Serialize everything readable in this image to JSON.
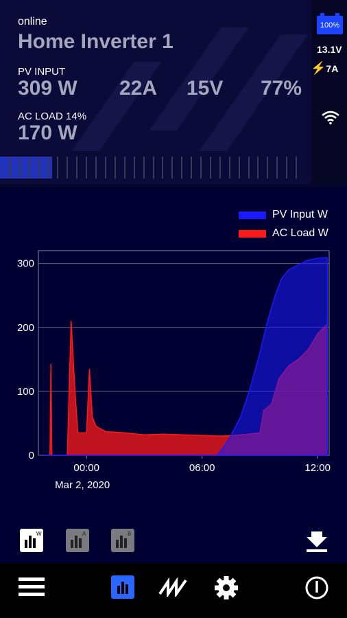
{
  "device": {
    "status": "online",
    "name": "Home Inverter 1"
  },
  "pv": {
    "label": "PV INPUT",
    "power": "309 W",
    "current": "22A",
    "voltage": "15V",
    "percent": "77%"
  },
  "ac": {
    "label": "AC LOAD 14%",
    "power": "170 W",
    "load_fraction": 0.14
  },
  "side": {
    "battery_percent": "100%",
    "battery_voltage": "13.1V",
    "charge_current": "7A"
  },
  "chart_data": {
    "type": "area",
    "series": [
      {
        "name": "PV Input W",
        "color": "#1a1aff"
      },
      {
        "name": "AC Load W",
        "color": "#ff1a1a"
      }
    ],
    "yticks": [
      "0",
      "100",
      "200",
      "300"
    ],
    "ylim": [
      0,
      320
    ],
    "xticks": [
      "00:00",
      "06:00",
      "12:00"
    ],
    "xdate": "Mar 2, 2020",
    "pv_points": [
      [
        -2.2,
        0
      ],
      [
        6.8,
        0
      ],
      [
        7.4,
        25
      ],
      [
        8.0,
        60
      ],
      [
        8.5,
        105
      ],
      [
        9.0,
        160
      ],
      [
        9.4,
        210
      ],
      [
        9.8,
        250
      ],
      [
        10.1,
        275
      ],
      [
        10.5,
        290
      ],
      [
        11.0,
        298
      ],
      [
        11.5,
        305
      ],
      [
        12.0,
        308
      ],
      [
        12.5,
        309
      ]
    ],
    "ac_points": [
      [
        -2.2,
        0
      ],
      [
        -1.9,
        0
      ],
      [
        -1.85,
        143
      ],
      [
        -1.8,
        0
      ],
      [
        -1.0,
        0
      ],
      [
        -0.8,
        210
      ],
      [
        -0.6,
        100
      ],
      [
        -0.45,
        35
      ],
      [
        0.0,
        35
      ],
      [
        0.15,
        135
      ],
      [
        0.3,
        60
      ],
      [
        0.5,
        45
      ],
      [
        1.0,
        37
      ],
      [
        2.0,
        35
      ],
      [
        3.0,
        32
      ],
      [
        4.0,
        33
      ],
      [
        5.0,
        32
      ],
      [
        6.0,
        31
      ],
      [
        7.0,
        30
      ],
      [
        8.0,
        32
      ],
      [
        9.0,
        35
      ],
      [
        9.2,
        70
      ],
      [
        9.6,
        80
      ],
      [
        10.0,
        120
      ],
      [
        10.5,
        140
      ],
      [
        11.0,
        150
      ],
      [
        11.5,
        165
      ],
      [
        12.0,
        190
      ],
      [
        12.5,
        205
      ]
    ]
  },
  "nav": {
    "items": [
      "menu",
      "charts",
      "stats",
      "settings",
      "power"
    ]
  }
}
